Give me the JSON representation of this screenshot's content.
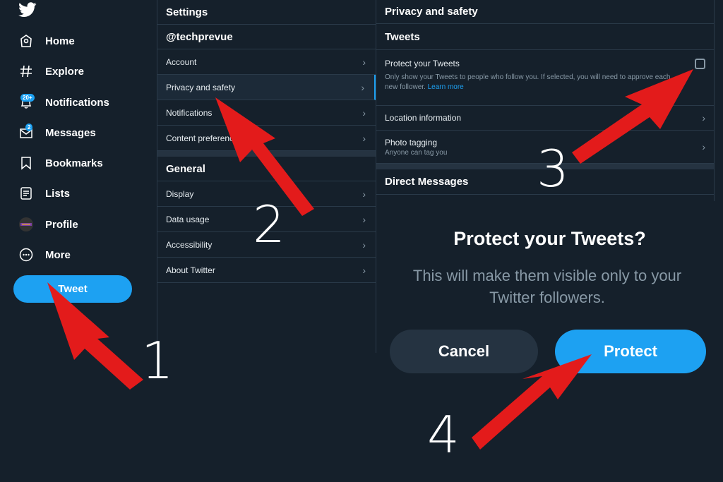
{
  "nav": {
    "items": [
      {
        "label": "Home",
        "icon": "home-icon"
      },
      {
        "label": "Explore",
        "icon": "hashtag-icon"
      },
      {
        "label": "Notifications",
        "icon": "bell-icon",
        "badge": "20+"
      },
      {
        "label": "Messages",
        "icon": "mail-icon",
        "badge": "2"
      },
      {
        "label": "Bookmarks",
        "icon": "bookmark-icon"
      },
      {
        "label": "Lists",
        "icon": "list-icon"
      },
      {
        "label": "Profile",
        "icon": "avatar"
      },
      {
        "label": "More",
        "icon": "more-icon"
      }
    ],
    "tweet_button": "Tweet"
  },
  "settings": {
    "title": "Settings",
    "account_handle": "@techprevue",
    "account_items": [
      "Account",
      "Privacy and safety",
      "Notifications",
      "Content preferences"
    ],
    "general_title": "General",
    "general_items": [
      "Display",
      "Data usage",
      "Accessibility",
      "About Twitter"
    ]
  },
  "privacy": {
    "title": "Privacy and safety",
    "tweets_section": "Tweets",
    "protect_label": "Protect your Tweets",
    "protect_desc": "Only show your Tweets to people who follow you. If selected, you will need to approve each new follower.",
    "learn_more": "Learn more",
    "protect_checked": false,
    "location_label": "Location information",
    "photo_label": "Photo tagging",
    "photo_sub": "Anyone can tag you",
    "dm_section": "Direct Messages"
  },
  "dialog": {
    "title": "Protect your Tweets?",
    "body": "This will make them visible only to your Twitter followers.",
    "cancel": "Cancel",
    "confirm": "Protect"
  },
  "annotations": {
    "steps": [
      "1",
      "2",
      "3",
      "4"
    ],
    "arrow_color": "#e31b1b"
  },
  "colors": {
    "background": "#15202b",
    "accent": "#1da1f2",
    "muted_text": "#8899a6"
  }
}
